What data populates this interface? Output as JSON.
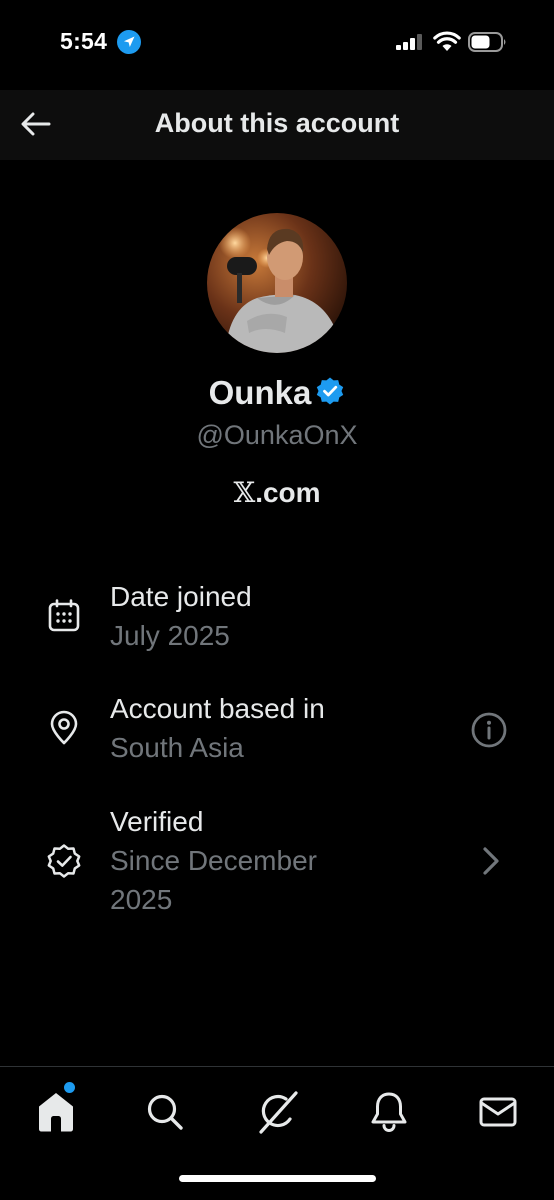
{
  "status_bar": {
    "time": "5:54"
  },
  "header": {
    "title": "About this account"
  },
  "profile": {
    "name": "Ounka",
    "handle": "@OunkaOnX",
    "affiliation_domain": ".com",
    "affiliation_logo": "𝕏"
  },
  "rows": {
    "date_joined": {
      "label": "Date joined",
      "value": "July 2025",
      "icon": "calendar-icon"
    },
    "based_in": {
      "label": "Account based in",
      "value": "South Asia",
      "icon": "location-pin-icon",
      "action_icon": "info-icon"
    },
    "verified": {
      "label": "Verified",
      "value_line1": "Since December",
      "value_line2": "2025",
      "icon": "verified-badge-icon",
      "action_icon": "chevron-right-icon"
    }
  },
  "tabs": [
    "home-icon",
    "search-icon",
    "grok-icon",
    "notifications-icon",
    "messages-icon"
  ],
  "colors": {
    "accent": "#1d9bf0",
    "background": "#000000",
    "header_background": "#0d0d0d",
    "primary_text": "#e7e9ea",
    "secondary_text": "#71767b"
  }
}
